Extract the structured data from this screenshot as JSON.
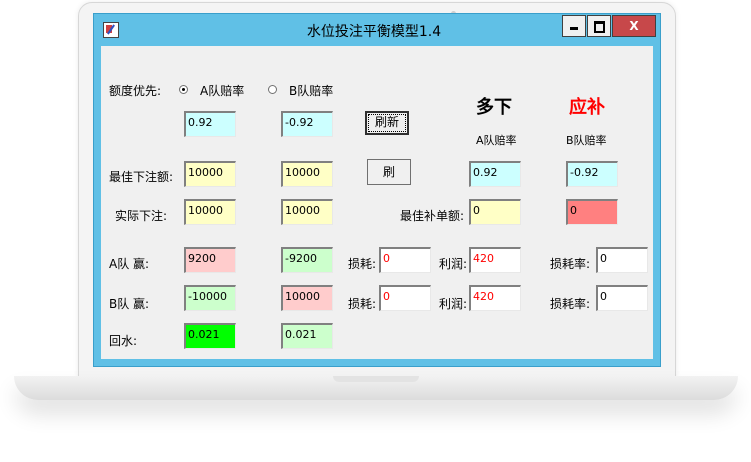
{
  "window": {
    "title": "水位投注平衡模型1.4",
    "close_glyph": "X"
  },
  "priority": {
    "label": "额度优先:",
    "option_a": "A队赔率",
    "option_b": "B队赔率",
    "selected": "A"
  },
  "odds_inputs": {
    "a": "0.92",
    "b": "-0.92"
  },
  "refresh_button": "刷新",
  "brush_button": "刷",
  "headers": {
    "more_down": "多下",
    "should_add": "应补",
    "a_odds": "A队赔率",
    "b_odds": "B队赔率"
  },
  "best_bet": {
    "label": "最佳下注额:",
    "a": "10000",
    "b": "10000"
  },
  "actual_bet": {
    "label": "实际下注:",
    "a": "10000",
    "b": "10000"
  },
  "right_odds": {
    "a": "0.92",
    "b": "-0.92"
  },
  "best_supplement": {
    "label": "最佳补单额:",
    "value": "0",
    "extra": "0"
  },
  "team_a_win": {
    "label": "A队 赢:",
    "a": "9200",
    "b": "-9200",
    "loss_label": "损耗:",
    "loss": "0",
    "profit_label": "利润:",
    "profit": "420",
    "loss_rate_label": "损耗率:",
    "loss_rate": "0"
  },
  "team_b_win": {
    "label": "B队 赢:",
    "a": "-10000",
    "b": "10000",
    "loss_label": "损耗:",
    "loss": "0",
    "profit_label": "利润:",
    "profit": "420",
    "loss_rate_label": "损耗率:",
    "loss_rate": "0"
  },
  "rebate": {
    "label": "回水:",
    "a": "0.021",
    "b": "0.021"
  },
  "colors": {
    "titlebar": "#60c0e6",
    "close_button": "#c7484a",
    "more_down": "#000000",
    "should_add": "#ff0000"
  }
}
